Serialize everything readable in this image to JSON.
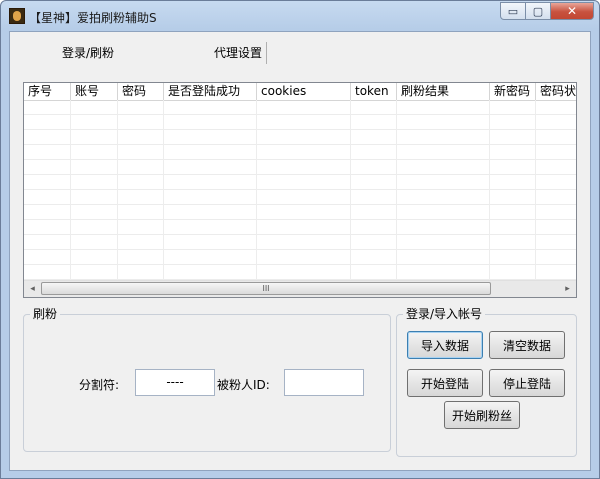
{
  "window": {
    "title": "【星神】爱拍刷粉辅助S",
    "minimize_glyph": "▭",
    "maximize_glyph": "▢",
    "close_glyph": "✕"
  },
  "tabs": [
    {
      "label": "登录/刷粉"
    },
    {
      "label": "代理设置"
    }
  ],
  "table": {
    "columns": [
      "序号",
      "账号",
      "密码",
      "是否登陆成功",
      "cookies",
      "token",
      "刷粉结果",
      "新密码",
      "密码状"
    ],
    "rows": []
  },
  "scrollbar": {
    "left_arrow": "◂",
    "right_arrow": "▸",
    "thumb_grip": "III"
  },
  "fans_group": {
    "title": "刷粉",
    "separator_label": "分割符:",
    "separator_value": "----",
    "target_id_label": "被粉人ID:",
    "target_id_value": ""
  },
  "account_group": {
    "title": "登录/导入帐号",
    "import_label": "导入数据",
    "clear_label": "清空数据",
    "start_login_label": "开始登陆",
    "stop_login_label": "停止登陆",
    "start_fans_label": "开始刷粉丝"
  }
}
